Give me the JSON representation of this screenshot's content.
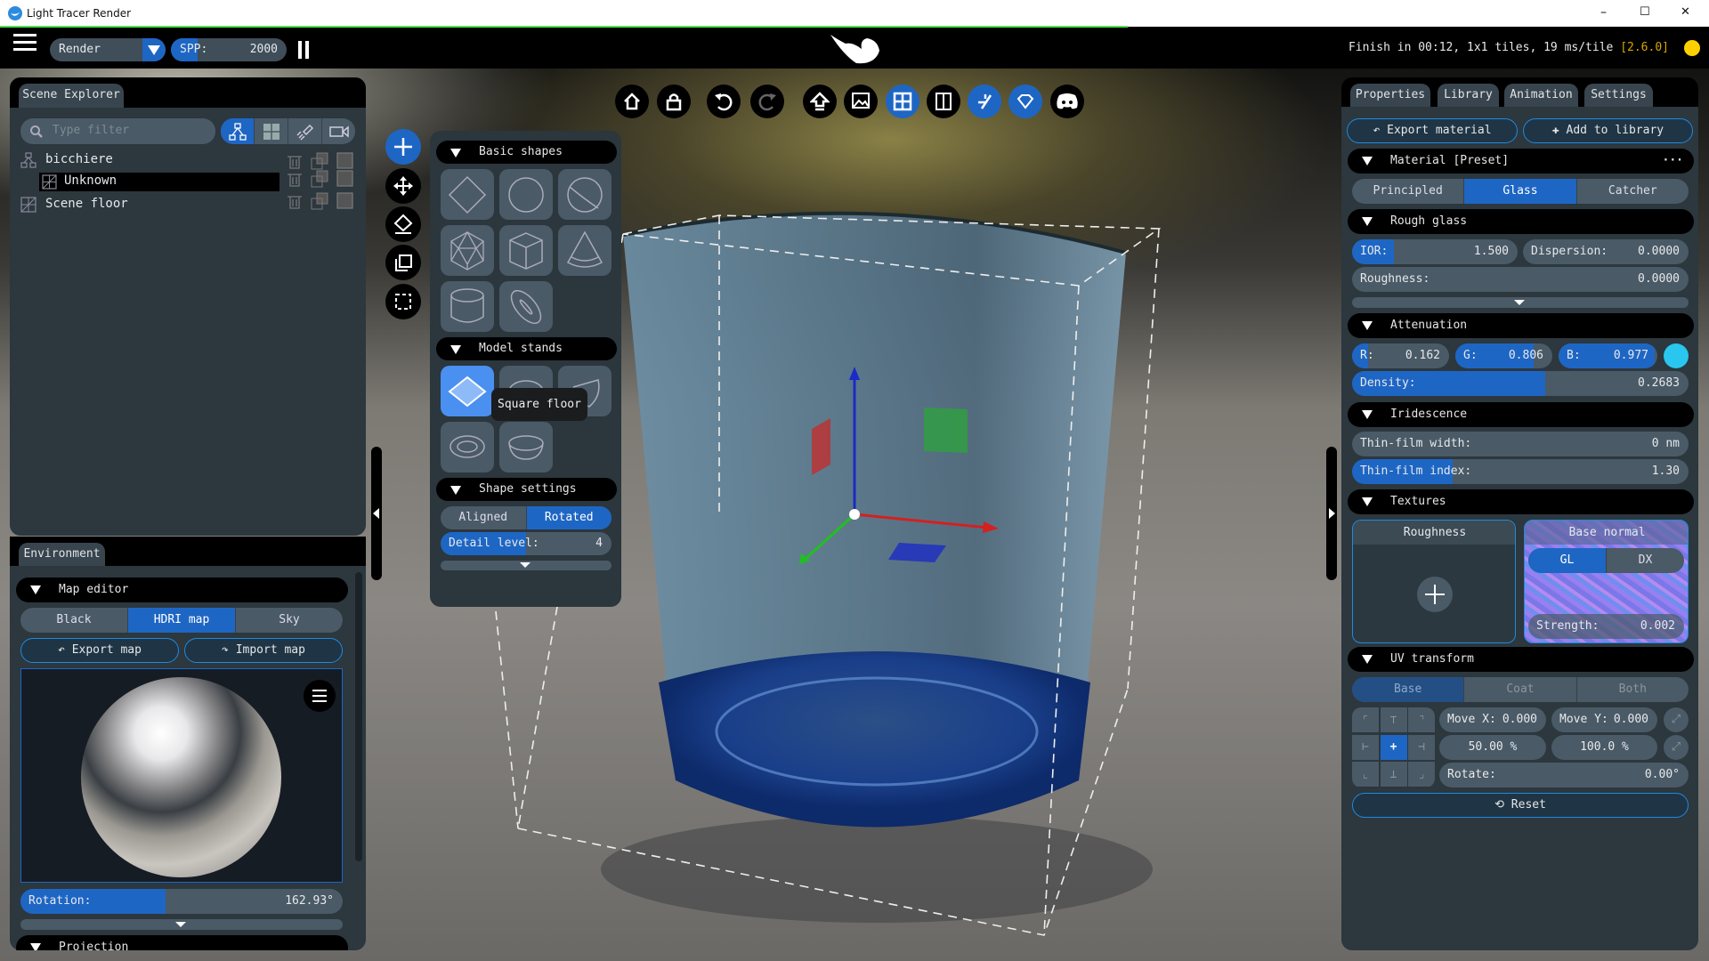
{
  "window": {
    "title": "Light Tracer Render",
    "minimize": "–",
    "maximize": "☐",
    "close": "✕"
  },
  "topbar": {
    "mode": "Render",
    "spp_label": "SPP:",
    "spp_value": "2000",
    "status": "Finish in 00:12, 1x1 tiles, 19 ms/tile",
    "version": "[2.6.0]",
    "render_progress": 0.66,
    "status_color": "#ffd000"
  },
  "toolbar": {
    "icons": [
      "home-icon",
      "lock-icon",
      "undo-icon",
      "redo-icon",
      "upload-icon",
      "image-icon",
      "grid-view-icon",
      "split-view-icon",
      "light-icon",
      "diamond-icon",
      "discord-icon"
    ]
  },
  "scene_explorer": {
    "tab": "Scene Explorer",
    "filter_placeholder": "Type filter",
    "items": [
      {
        "label": "bicchiere"
      },
      {
        "label": "Unknown"
      },
      {
        "label": "Scene floor"
      }
    ]
  },
  "environment": {
    "tab": "Environment",
    "map_editor": "Map editor",
    "modes": [
      "Black",
      "HDRI map",
      "Sky"
    ],
    "selected_mode": "HDRI map",
    "export": "Export map",
    "import": "Import map",
    "rotation_label": "Rotation:",
    "rotation_value": "162.93°",
    "rotation_fraction": 0.45,
    "projection": "Projection"
  },
  "shapes": {
    "basic": "Basic shapes",
    "stands": "Model stands",
    "tooltip": "Square floor",
    "settings": "Shape settings",
    "aligned": "Aligned",
    "rotated": "Rotated",
    "detail_label": "Detail level:",
    "detail_value": "4",
    "detail_fraction": 0.5
  },
  "properties": {
    "tabs": [
      "Properties",
      "Library",
      "Animation",
      "Settings"
    ],
    "export_material": "Export material",
    "add_to_library": "Add to library",
    "material_header": "Material [Preset]",
    "more": "···",
    "material_types": [
      "Principled",
      "Glass",
      "Catcher"
    ],
    "selected_type": "Glass",
    "rough_glass": "Rough glass",
    "ior_label": "IOR:",
    "ior_value": "1.500",
    "ior_fraction": 0.25,
    "dispersion_label": "Dispersion:",
    "dispersion_value": "0.0000",
    "roughness_label": "Roughness:",
    "roughness_value": "0.0000",
    "attenuation": "Attenuation",
    "r_label": "R:",
    "r_value": "0.162",
    "r_fraction": 0.162,
    "g_label": "G:",
    "g_value": "0.806",
    "g_fraction": 0.806,
    "b_label": "B:",
    "b_value": "0.977",
    "b_fraction": 0.977,
    "attenuation_color": "#29c6f0",
    "density_label": "Density:",
    "density_value": "0.2683",
    "density_fraction": 0.575,
    "iridescence": "Iridescence",
    "tf_width_label": "Thin-film width:",
    "tf_width_value": "0 nm",
    "tf_index_label": "Thin-film index:",
    "tf_index_value": "1.30",
    "tf_index_fraction": 0.3,
    "textures": "Textures",
    "tex_roughness": "Roughness",
    "tex_base_normal": "Base normal",
    "normal_modes": [
      "GL",
      "DX"
    ],
    "normal_selected": "GL",
    "strength_label": "Strength:",
    "strength_value": "0.002",
    "uv_transform": "UV transform",
    "uv_targets": [
      "Base",
      "Coat",
      "Both"
    ],
    "uv_selected": "Base",
    "move_x_label": "Move X:",
    "move_x_value": "0.000",
    "move_y_label": "Move Y:",
    "move_y_value": "0.000",
    "scale_x": "50.00 %",
    "scale_y": "100.0 %",
    "rotate_label": "Rotate:",
    "rotate_value": "0.00°",
    "reset": "Reset"
  }
}
